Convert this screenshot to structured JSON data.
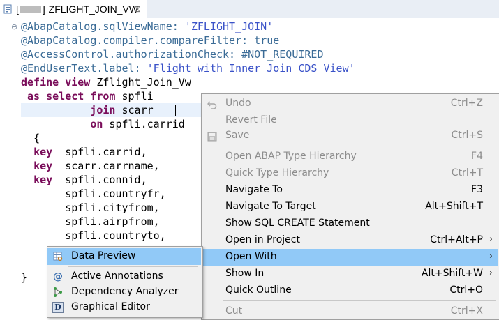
{
  "tab": {
    "bracket_open": "[",
    "bracket_close": "]",
    "title": "ZFLIGHT_JOIN_VW",
    "close_glyph": "⊠",
    "icon": "cds-view-file-icon"
  },
  "code": {
    "fold_glyph": "⊖",
    "lines": [
      {
        "anno": "@AbapCatalog.sqlViewName: ",
        "str": "'ZFLIGHT_JOIN'"
      },
      {
        "anno": "@AbapCatalog.compiler.compareFilter: true"
      },
      {
        "anno": "@AccessControl.authorizationCheck: #NOT_REQUIRED"
      },
      {
        "anno": "@EndUserText.label: ",
        "str": "'Flight with Inner Join CDS View'"
      },
      {
        "kw": "define view",
        "text": " Zflight_Join_Vw"
      },
      {
        "indent": " ",
        "kw": "as select from",
        "text": " spfli"
      },
      {
        "indent": "           ",
        "kw": "join",
        "text": " scarr"
      },
      {
        "indent": "           ",
        "kw": "on",
        "text": " spfli.carrid"
      },
      {
        "indent": "  ",
        "text": "{"
      },
      {
        "indent": "  ",
        "kw": "key",
        "text": "  spfli.carrid,"
      },
      {
        "indent": "  ",
        "kw": "key",
        "text": "  scarr.carrname,"
      },
      {
        "indent": "  ",
        "kw": "key",
        "text": "  spfli.connid,"
      },
      {
        "indent": "",
        "text": "       spfli.countryfr,"
      },
      {
        "indent": "",
        "text": "       spfli.cityfrom,"
      },
      {
        "indent": "",
        "text": "       spfli.airpfrom,"
      },
      {
        "indent": "",
        "text": "       spfli.countryto,"
      },
      {
        "indent": "",
        "text": ""
      },
      {
        "indent": "",
        "text": ""
      },
      {
        "indent": "",
        "text": "}"
      }
    ]
  },
  "context_menu": {
    "items": [
      {
        "label": "Undo",
        "accel": "Ctrl+Z",
        "enabled": false,
        "icon": "undo-icon"
      },
      {
        "label": "Revert File",
        "accel": "",
        "enabled": false,
        "icon": ""
      },
      {
        "label": "Save",
        "accel": "Ctrl+S",
        "enabled": false,
        "icon": "save-icon"
      },
      {
        "label": "Open ABAP Type Hierarchy",
        "accel": "F4",
        "enabled": false,
        "icon": ""
      },
      {
        "label": "Quick Type Hierarchy",
        "accel": "Ctrl+T",
        "enabled": false,
        "icon": ""
      },
      {
        "label": "Navigate To",
        "accel": "F3",
        "enabled": true,
        "icon": ""
      },
      {
        "label": "Navigate To Target",
        "accel": "Alt+Shift+T",
        "enabled": true,
        "icon": ""
      },
      {
        "label": "Show SQL CREATE Statement",
        "accel": "",
        "enabled": true,
        "icon": ""
      },
      {
        "label": "Open in Project",
        "accel": "Ctrl+Alt+P",
        "enabled": true,
        "icon": "",
        "submenu": true
      },
      {
        "label": "Open With",
        "accel": "",
        "enabled": true,
        "icon": "",
        "submenu": true,
        "highlighted": true
      },
      {
        "label": "Show In",
        "accel": "Alt+Shift+W",
        "enabled": true,
        "icon": "",
        "submenu": true
      },
      {
        "label": "Quick Outline",
        "accel": "Ctrl+O",
        "enabled": true,
        "icon": ""
      },
      {
        "label": "Cut",
        "accel": "Ctrl+X",
        "enabled": false,
        "icon": ""
      }
    ],
    "submenu_arrow": "›"
  },
  "submenu": {
    "items": [
      {
        "label": "Data Preview",
        "icon": "data-preview-icon",
        "highlighted": true
      },
      {
        "label": "Active Annotations",
        "icon": "at-sign-icon"
      },
      {
        "label": "Dependency Analyzer",
        "icon": "dependency-graph-icon"
      },
      {
        "label": "Graphical Editor",
        "icon": "cds-d-icon"
      }
    ]
  },
  "colors": {
    "menu_highlight": "#91c9f7",
    "keyword": "#7a0d5a",
    "annotation": "#3a6b96",
    "string": "#3a52c8",
    "current_line": "#e8f1fc"
  }
}
